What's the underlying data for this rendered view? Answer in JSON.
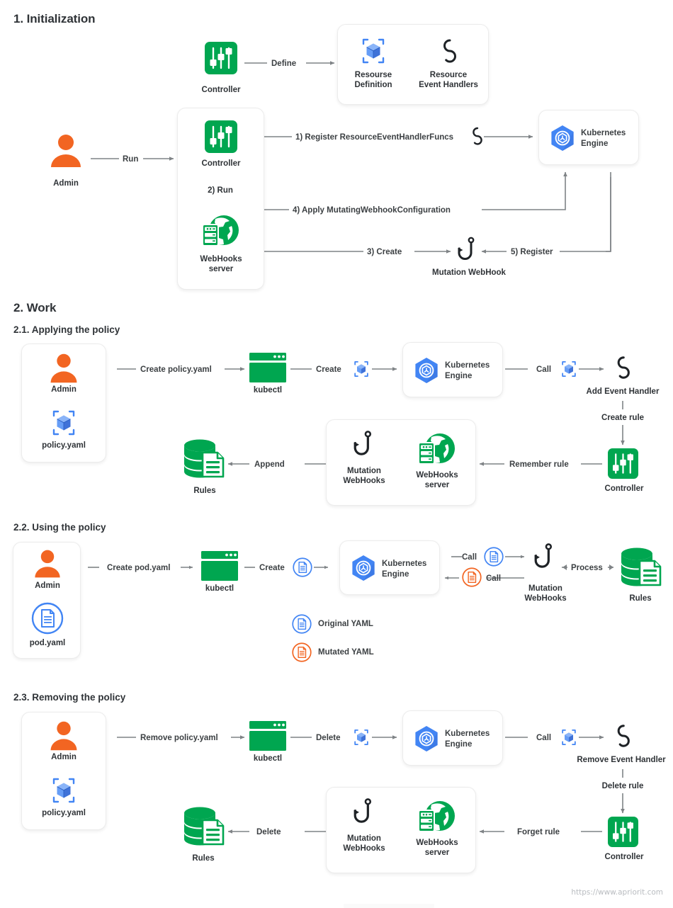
{
  "page": {
    "footer_url": "https://www.apriorit.com"
  },
  "sections": {
    "s1_title": "1. Initialization",
    "s2_title": "2. Work",
    "s21_title": "2.1. Applying the policy",
    "s22_title": "2.2. Using the policy",
    "s23_title": "2.3. Removing the policy"
  },
  "colors": {
    "green": "#00a650",
    "green_dark": "#009444",
    "orange": "#f26522",
    "blue": "#4285f4",
    "blue_light": "#669df6",
    "dark": "#2f3337",
    "line": "#7f8386"
  },
  "section1": {
    "controller_top_label": "Controller",
    "define_label": "Define",
    "resource_definition_label": "Resourse\nDefinition",
    "resource_definition_line1": "Resourse",
    "resource_definition_line2": "Definition",
    "resource_event_handlers_line1": "Resource",
    "resource_event_handlers_line2": "Event Handlers",
    "admin_label": "Admin",
    "run_label": "Run",
    "controller_label": "Controller",
    "step1_label": "1) Register ResourceEventHandlerFuncs",
    "step2_label": "2) Run",
    "step3_label": "3) Create",
    "step4_label": "4) Apply MutatingWebhookConfiguration",
    "step5_label": "5) Register",
    "webhooks_server_line1": "WebHooks",
    "webhooks_server_line2": "server",
    "kubernetes_engine_line1": "Kubernetes",
    "kubernetes_engine_line2": "Engine",
    "mutation_webhook_label": "Mutation WebHook"
  },
  "section21": {
    "admin_label": "Admin",
    "policy_yaml_label": "policy.yaml",
    "create_policy_label": "Create policy.yaml",
    "kubectl_label": "kubectl",
    "create_label": "Create",
    "kubernetes_engine_line1": "Kubernetes",
    "kubernetes_engine_line2": "Engine",
    "call_label": "Call",
    "add_event_handler_label": "Add Event Handler",
    "create_rule_label": "Create rule",
    "controller_label": "Controller",
    "remember_rule_label": "Remember rule",
    "mutation_webhooks_line1": "Mutation",
    "mutation_webhooks_line2": "WebHooks",
    "webhooks_server_line1": "WebHooks",
    "webhooks_server_line2": "server",
    "append_label": "Append",
    "rules_label": "Rules"
  },
  "section22": {
    "admin_label": "Admin",
    "pod_yaml_label": "pod.yaml",
    "create_pod_label": "Create pod.yaml",
    "kubectl_label": "kubectl",
    "create_label": "Create",
    "kubernetes_engine_line1": "Kubernetes",
    "kubernetes_engine_line2": "Engine",
    "call_top_label": "Call",
    "call_bottom_label": "Call",
    "mutation_webhooks_line1": "Mutation",
    "mutation_webhooks_line2": "WebHooks",
    "process_label": "Process",
    "rules_label": "Rules",
    "legend_original": "Original YAML",
    "legend_mutated": "Mutated YAML"
  },
  "section23": {
    "admin_label": "Admin",
    "policy_yaml_label": "policy.yaml",
    "remove_policy_label": "Remove policy.yaml",
    "kubectl_label": "kubectl",
    "delete_label": "Delete",
    "kubernetes_engine_line1": "Kubernetes",
    "kubernetes_engine_line2": "Engine",
    "call_label": "Call",
    "remove_event_handler_label": "Remove Event Handler",
    "delete_rule_label": "Delete rule",
    "controller_label": "Controller",
    "forget_rule_label": "Forget rule",
    "mutation_webhooks_line1": "Mutation",
    "mutation_webhooks_line2": "WebHooks",
    "webhooks_server_line1": "WebHooks",
    "webhooks_server_line2": "server",
    "delete_rules_label": "Delete",
    "rules_label": "Rules"
  }
}
